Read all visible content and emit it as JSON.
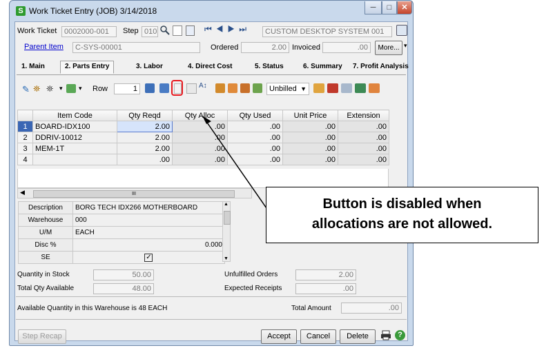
{
  "window": {
    "title": "Work Ticket Entry (JOB) 3/14/2018",
    "app_icon": "S"
  },
  "header": {
    "work_ticket_label": "Work Ticket",
    "work_ticket_value": "0002000-001",
    "step_label": "Step",
    "step_value": "010",
    "description": "CUSTOM DESKTOP SYSTEM 001",
    "parent_item_label": "Parent Item",
    "parent_item_value": "C-SYS-00001",
    "ordered_label": "Ordered",
    "ordered_value": "2.00",
    "invoiced_label": "Invoiced",
    "invoiced_value": ".00",
    "more_button": "More..."
  },
  "tabs": [
    {
      "label": "1. Main"
    },
    {
      "label": "2. Parts Entry"
    },
    {
      "label": "3. Labor"
    },
    {
      "label": "4. Direct Cost"
    },
    {
      "label": "5. Status"
    },
    {
      "label": "6. Summary"
    },
    {
      "label": "7. Profit Analysis"
    }
  ],
  "toolbar": {
    "row_label": "Row",
    "row_value": "1",
    "billing_select": "Unbilled"
  },
  "grid": {
    "columns": [
      "",
      "Item Code",
      "Qty Reqd",
      "Qty Alloc",
      "Qty Used",
      "Unit Price",
      "Extension"
    ],
    "rows": [
      {
        "n": "1",
        "item": "BOARD-IDX100",
        "reqd": "2.00",
        "alloc": ".00",
        "used": ".00",
        "price": ".00",
        "ext": ".00"
      },
      {
        "n": "2",
        "item": "DDRIV-10012",
        "reqd": "2.00",
        "alloc": ".00",
        "used": ".00",
        "price": ".00",
        "ext": ".00"
      },
      {
        "n": "3",
        "item": "MEM-1T",
        "reqd": "2.00",
        "alloc": ".00",
        "used": ".00",
        "price": ".00",
        "ext": ".00"
      },
      {
        "n": "4",
        "item": "",
        "reqd": ".00",
        "alloc": ".00",
        "used": ".00",
        "price": ".00",
        "ext": ".00"
      }
    ],
    "scroll_mark": "III"
  },
  "detail": {
    "description_label": "Description",
    "description_value": "BORG TECH IDX266 MOTHERBOARD",
    "warehouse_label": "Warehouse",
    "warehouse_value": "000",
    "um_label": "U/M",
    "um_value": "EACH",
    "disc_label": "Disc %",
    "disc_value": "0.000",
    "se_label": "SE",
    "se_checked": true
  },
  "summary": {
    "qty_in_stock_label": "Quantity in Stock",
    "qty_in_stock_value": "50.00",
    "total_qty_available_label": "Total Qty Available",
    "total_qty_available_value": "48.00",
    "unfulfilled_orders_label": "Unfulfilled Orders",
    "unfulfilled_orders_value": "2.00",
    "expected_receipts_label": "Expected Receipts",
    "expected_receipts_value": ".00",
    "available_message": "Available Quantity in this Warehouse is 48 EACH",
    "total_amount_label": "Total Amount",
    "total_amount_value": ".00"
  },
  "footer": {
    "step_recap": "Step Recap",
    "accept": "Accept",
    "cancel": "Cancel",
    "delete": "Delete"
  },
  "callout": {
    "line1": "Button is disabled when",
    "line2": "allocations are not allowed."
  },
  "colors": {
    "highlight_box": "#e8191f",
    "selected_row": "#3a66b4",
    "window_frame": "#c9d9ec"
  }
}
